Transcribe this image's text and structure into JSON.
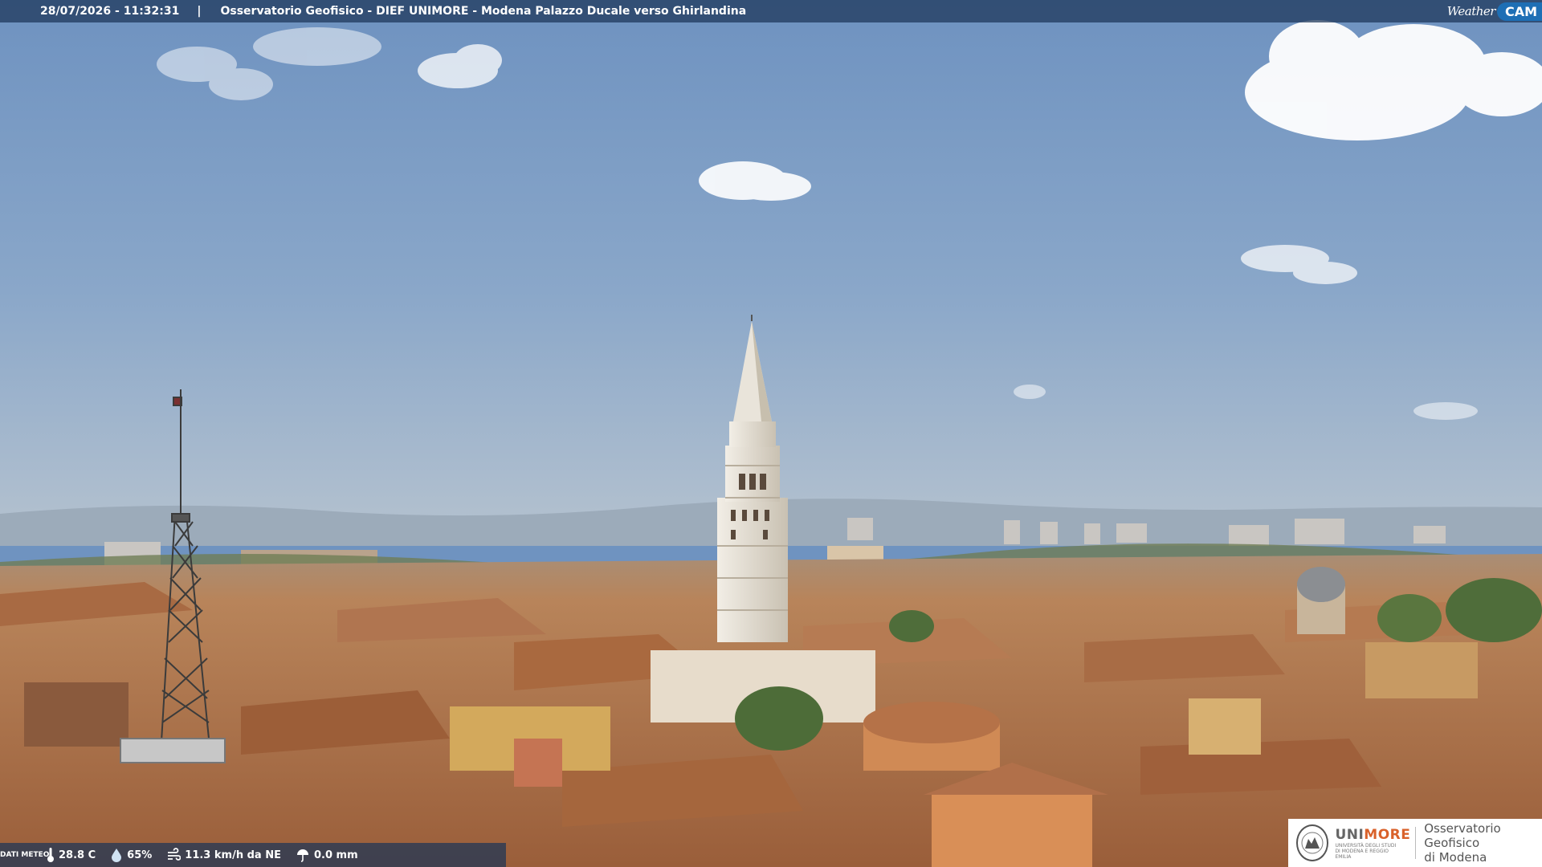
{
  "header": {
    "timestamp": "28/07/2026 - 11:32:31",
    "separator": "|",
    "title": "Osservatorio Geofisico - DIEF UNIMORE - Modena Palazzo Ducale verso Ghirlandina"
  },
  "brand_logo": {
    "weather_text": "Weather",
    "cam_text": "CAM"
  },
  "meteo": {
    "label": "DATI METEO",
    "temperature": "28.8 C",
    "humidity": "65%",
    "wind": "11.3 km/h da NE",
    "rain": "0.0 mm",
    "icons": [
      "thermometer-icon",
      "humidity-drop-icon",
      "wind-icon",
      "rain-icon"
    ]
  },
  "institution": {
    "uni_prefix": "UNI",
    "uni_suffix": "MORE",
    "uni_subtitle": "UNIVERSITÀ DEGLI STUDI DI MODENA E REGGIO EMILIA",
    "observatory_line1": "Osservatorio Geofisico",
    "observatory_line2": "di Modena"
  },
  "colors": {
    "sky_top": "#6e92c0",
    "sky_horizon": "#aebdcc",
    "roof": "#b97a4f",
    "tower": "#e8e2d6",
    "accent_orange": "#d9622b",
    "cam_blue": "#1e6fb5"
  }
}
